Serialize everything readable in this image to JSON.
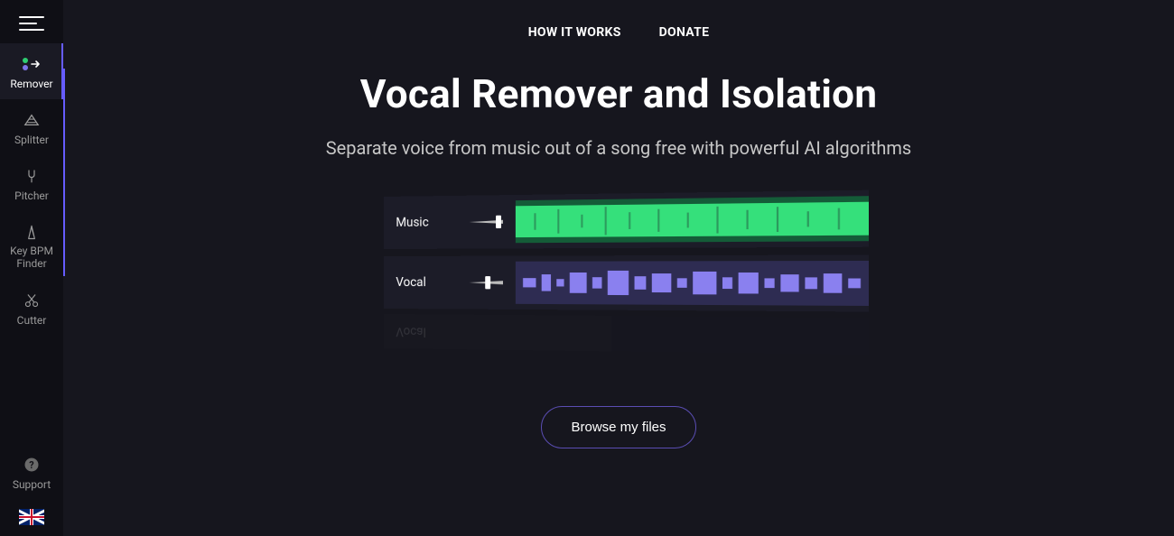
{
  "topnav": {
    "how_it_works": "HOW IT WORKS",
    "donate": "DONATE"
  },
  "hero": {
    "title": "Vocal Remover and Isolation",
    "subtitle": "Separate voice from music out of a song free with powerful AI algorithms"
  },
  "sidebar": {
    "items": [
      {
        "label": "Remover",
        "icon": "remover-icon",
        "active": true
      },
      {
        "label": "Splitter",
        "icon": "splitter-icon",
        "active": false
      },
      {
        "label": "Pitcher",
        "icon": "pitcher-icon",
        "active": false
      },
      {
        "label": "Key BPM Finder",
        "icon": "keybpm-icon",
        "active": false
      },
      {
        "label": "Cutter",
        "icon": "cutter-icon",
        "active": false
      },
      {
        "label": "Support",
        "icon": "support-icon",
        "active": false
      }
    ]
  },
  "tracks": {
    "music": {
      "label": "Music",
      "color": "#2ecc71"
    },
    "vocal": {
      "label": "Vocal",
      "color": "#7e74e8"
    }
  },
  "actions": {
    "browse": "Browse my files"
  },
  "language": "en-GB"
}
